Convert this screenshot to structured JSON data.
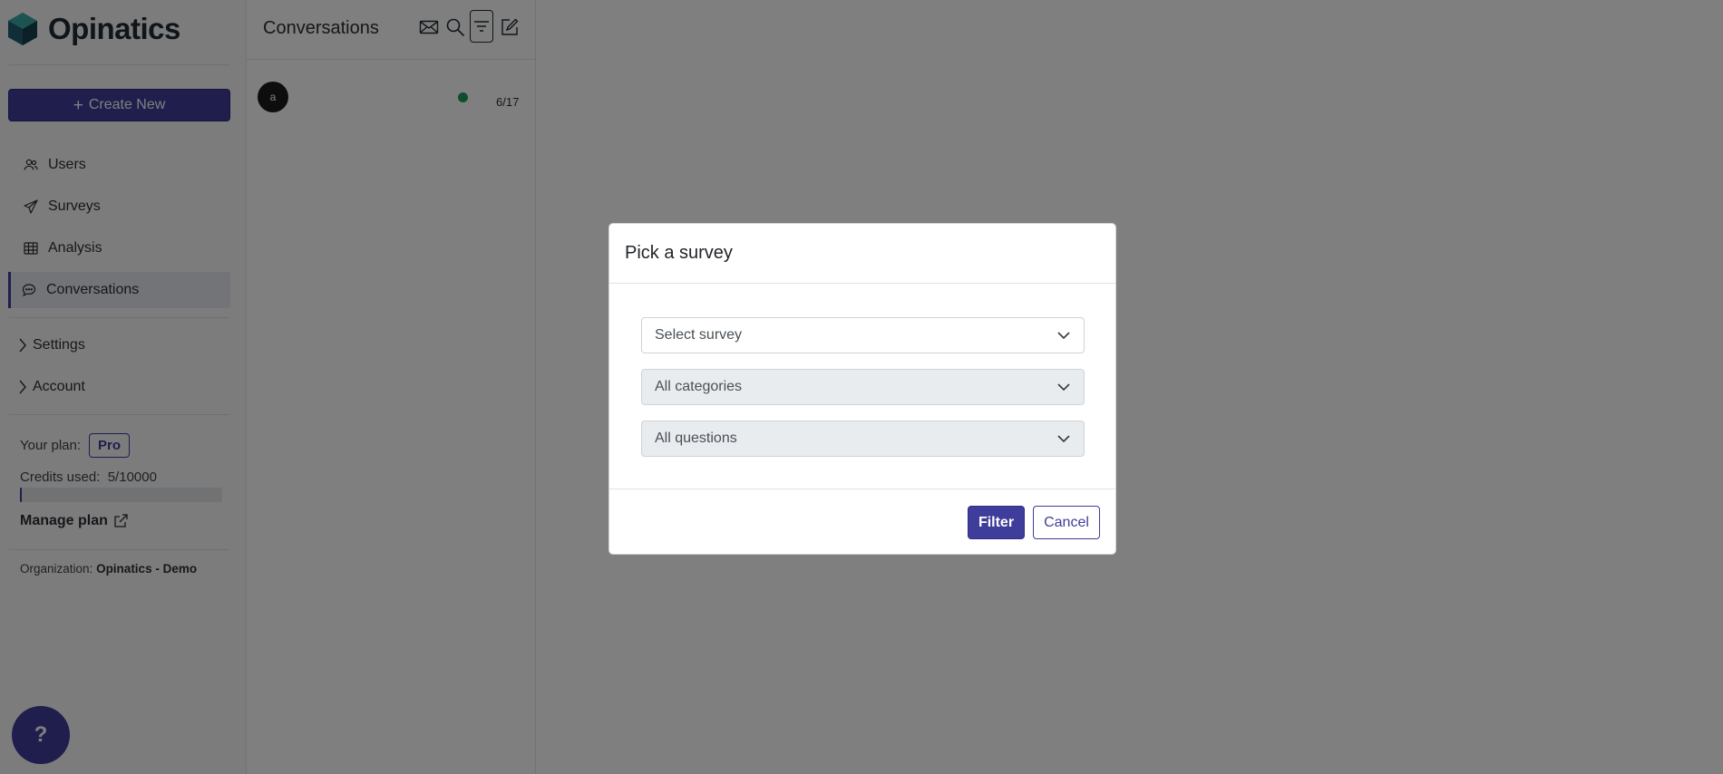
{
  "app": {
    "name": "Opinatics"
  },
  "sidebar": {
    "create_label": "Create New",
    "nav": [
      {
        "label": "Users",
        "icon": "users-icon"
      },
      {
        "label": "Surveys",
        "icon": "paper-plane-icon"
      },
      {
        "label": "Analysis",
        "icon": "table-icon"
      },
      {
        "label": "Conversations",
        "icon": "chat-icon",
        "active": true
      }
    ],
    "groups": [
      {
        "label": "Settings",
        "icon": "chevron-right-icon"
      },
      {
        "label": "Account",
        "icon": "chevron-right-icon"
      }
    ],
    "plan_label": "Your plan:",
    "plan_name": "Pro",
    "credits_label": "Credits used:",
    "credits_value": "5/10000",
    "credits_fraction": 0.0005,
    "manage_label": "Manage plan",
    "org_label": "Organization:",
    "org_name": "Opinatics - Demo",
    "help_label": "?"
  },
  "conversations": {
    "title": "Conversations",
    "header_icons": [
      "mail-icon",
      "search-icon",
      "filter-icon",
      "edit-icon"
    ],
    "items": [
      {
        "avatar": "a",
        "count": "6/17",
        "status": "online"
      }
    ]
  },
  "modal": {
    "title": "Pick a survey",
    "selects": [
      {
        "value": "Select survey"
      },
      {
        "value": "All categories",
        "disabled": true
      },
      {
        "value": "All questions",
        "disabled": true
      }
    ],
    "primary_label": "Filter",
    "secondary_label": "Cancel"
  },
  "colors": {
    "accent": "#3f3d9b",
    "status_online": "#1a9c5b",
    "backdrop": "rgba(0,0,0,0.5)"
  }
}
